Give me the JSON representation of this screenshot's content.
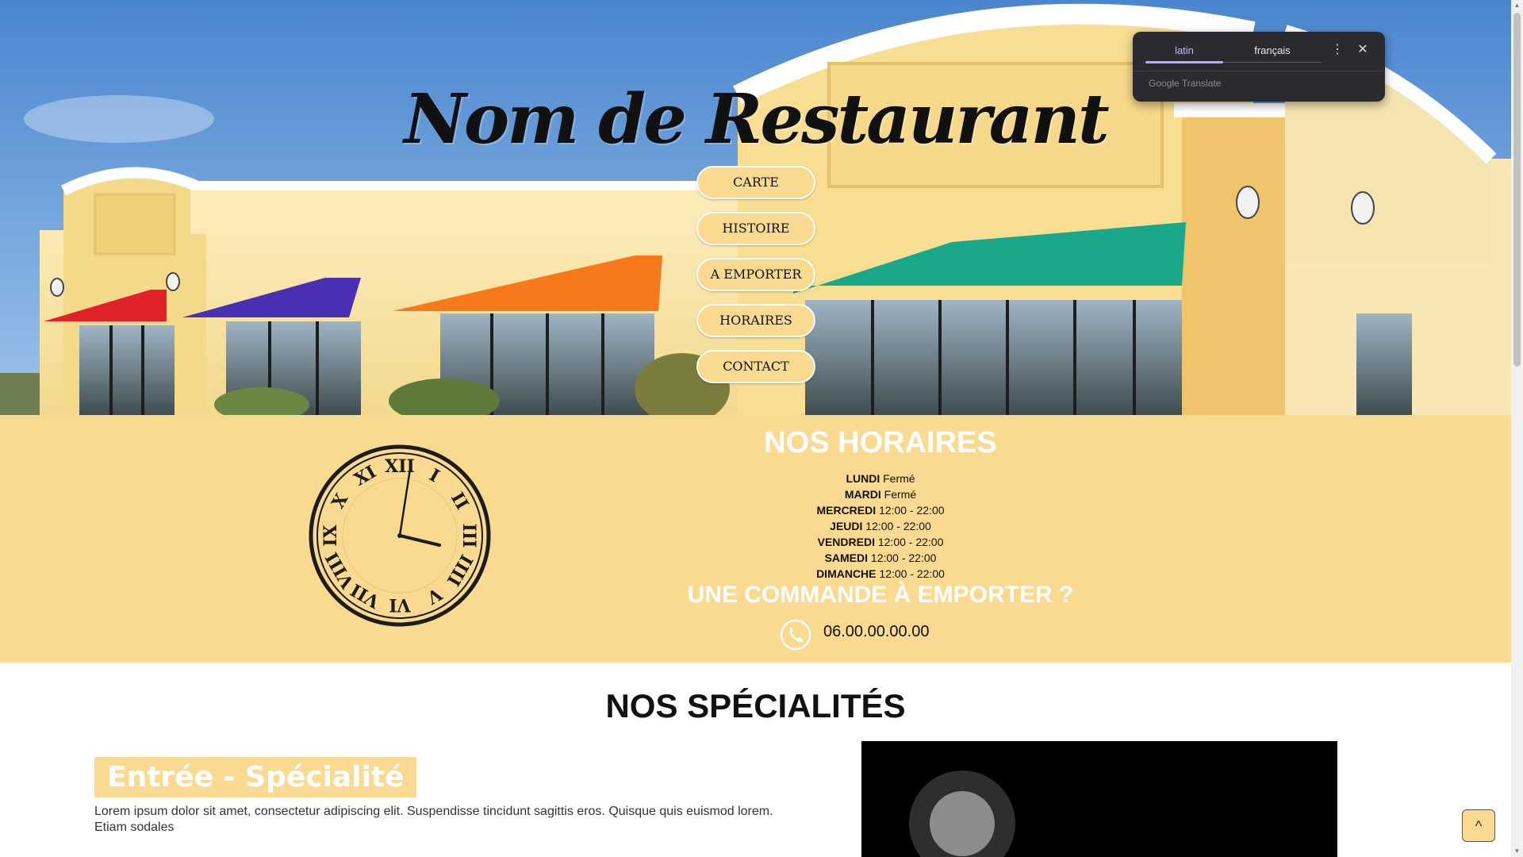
{
  "site": {
    "title": "Nom de Restaurant"
  },
  "nav": {
    "items": [
      {
        "label": "CARTE"
      },
      {
        "label": "HISTOIRE"
      },
      {
        "label": "A EMPORTER"
      },
      {
        "label": "HORAIRES"
      },
      {
        "label": "CONTACT"
      }
    ]
  },
  "translate_popup": {
    "source_tab": "latin",
    "target_tab": "français",
    "more_icon": "vertical-dots-icon",
    "close_icon": "close-icon",
    "brand": "Google Translate"
  },
  "hours": {
    "title": "NOS HORAIRES",
    "schedule": [
      {
        "day": "LUNDI",
        "time": "Fermé"
      },
      {
        "day": "MARDI",
        "time": "Fermé"
      },
      {
        "day": "MERCREDI",
        "time": "12:00 - 22:00"
      },
      {
        "day": "JEUDI",
        "time": "12:00 - 22:00"
      },
      {
        "day": "VENDREDI",
        "time": "12:00 - 22:00"
      },
      {
        "day": "SAMEDI",
        "time": "12:00 - 22:00"
      },
      {
        "day": "DIMANCHE",
        "time": "12:00 - 22:00"
      }
    ],
    "takeaway_title": "UNE COMMANDE À EMPORTER ?",
    "phone": "06.00.00.00.00"
  },
  "specialties": {
    "title": "NOS SPÉCIALITÉS",
    "items": [
      {
        "label": "Entrée - Spécialité",
        "description": "Lorem ipsum dolor sit amet, consectetur adipiscing elit. Suspendisse tincidunt sagittis eros. Quisque quis euismod lorem. Etiam sodales"
      }
    ]
  },
  "back_to_top": {
    "label": "^"
  },
  "colors": {
    "accent": "#f9da90",
    "popup_bg": "#2b2a30",
    "popup_active": "#c5b8ff"
  }
}
